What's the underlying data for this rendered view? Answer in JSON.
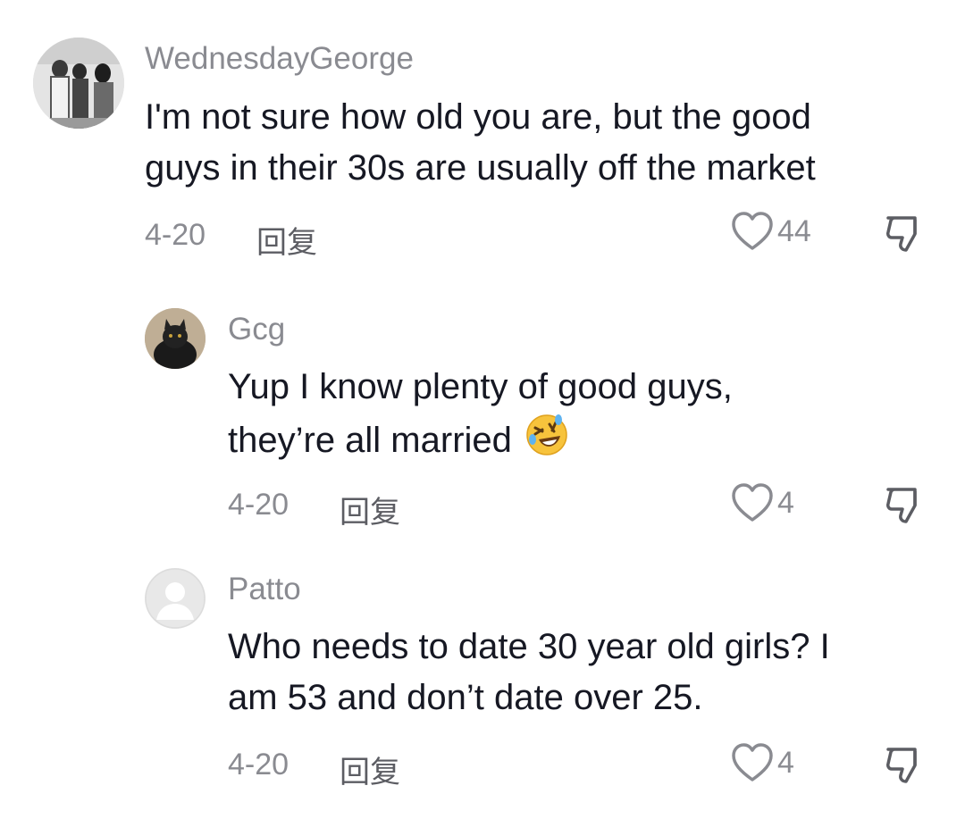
{
  "comments": [
    {
      "username": "WednesdayGeorge",
      "lines": [
        "I'm not sure how old you are, but the good",
        "guys in their 30s are usually off the market"
      ],
      "date": "4-20",
      "reply_label": "回复",
      "likes": "44"
    },
    {
      "username": "Gcg",
      "lines": [
        "Yup I know plenty of good guys,",
        "they’re all married"
      ],
      "emoji": "rolling-on-floor-laughing",
      "date": "4-20",
      "reply_label": "回复",
      "likes": "4"
    },
    {
      "username": "Patto",
      "lines": [
        "Who needs to date 30 year old girls? I",
        "am 53 and don’t date over 25."
      ],
      "date": "4-20",
      "reply_label": "回复",
      "likes": "4"
    }
  ],
  "colors": {
    "username": "#8a8b91",
    "text": "#161823",
    "meta": "#8a8b91"
  }
}
